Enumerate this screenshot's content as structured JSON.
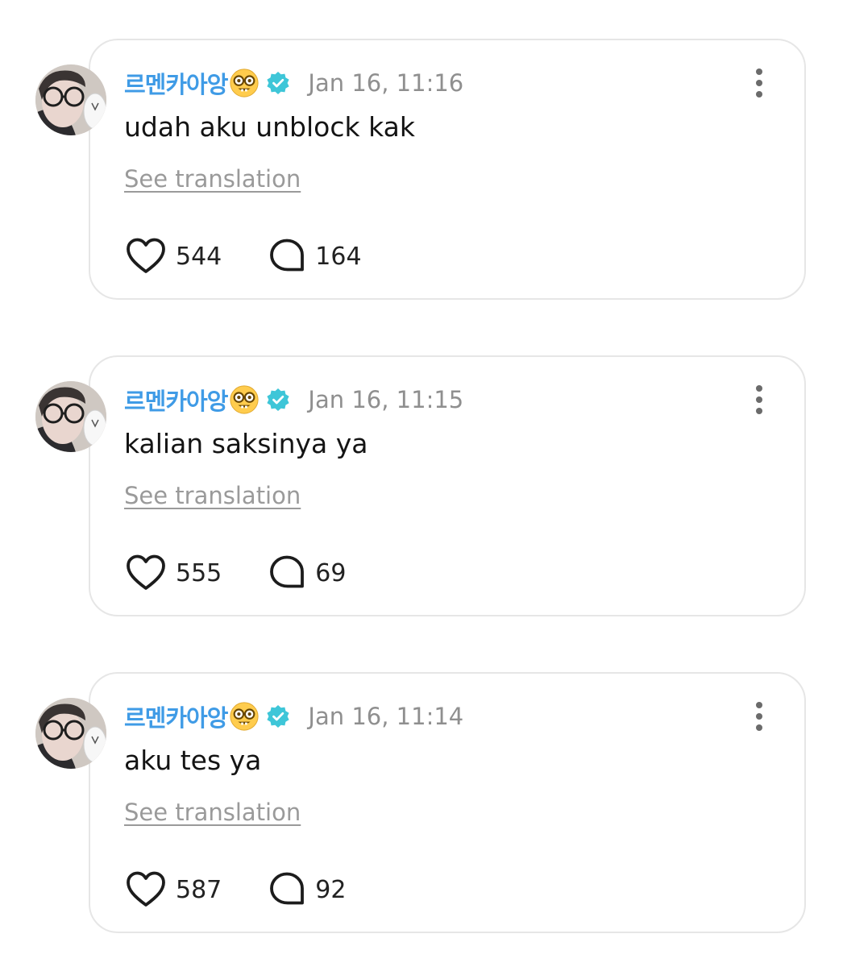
{
  "colors": {
    "username": "#3f9be6",
    "verified_badge": "#3ec6d8",
    "timestamp": "#8f8f8f",
    "card_border": "#e6e6e6"
  },
  "posts": [
    {
      "username": "르멘카아앙",
      "username_emoji": "nerd-face-emoji",
      "verified_icon": "verified-badge-icon",
      "timestamp": "Jan 16, 11:16",
      "text": "udah aku unblock kak",
      "translation_link": "See translation",
      "likes": "544",
      "comments": "164"
    },
    {
      "username": "르멘카아앙",
      "username_emoji": "nerd-face-emoji",
      "verified_icon": "verified-badge-icon",
      "timestamp": "Jan 16, 11:15",
      "text": "kalian saksinya ya",
      "translation_link": "See translation",
      "likes": "555",
      "comments": "69"
    },
    {
      "username": "르멘카아앙",
      "username_emoji": "nerd-face-emoji",
      "verified_icon": "verified-badge-icon",
      "timestamp": "Jan 16, 11:14",
      "text": "aku tes ya",
      "translation_link": "See translation",
      "likes": "587",
      "comments": "92"
    }
  ]
}
